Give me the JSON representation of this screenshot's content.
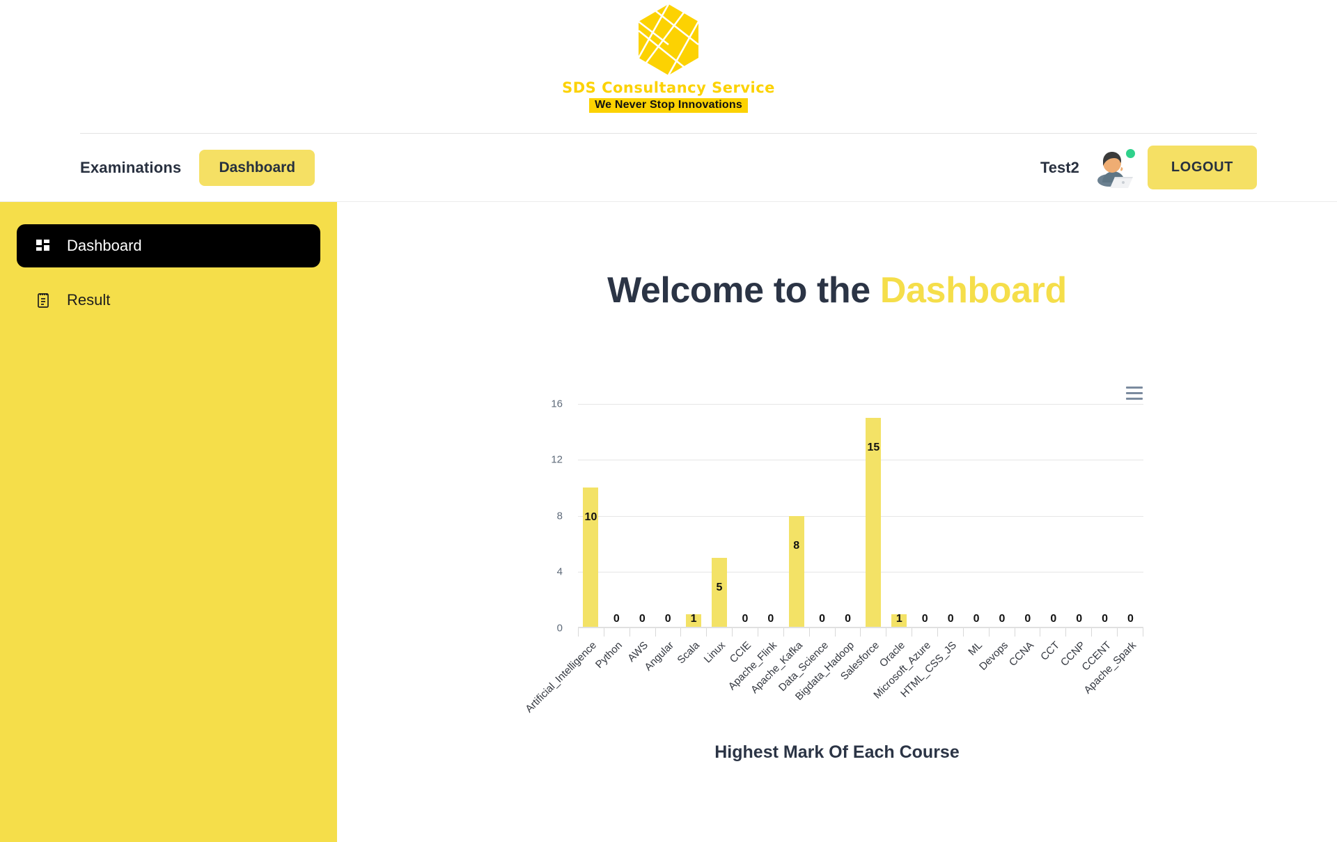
{
  "brand": {
    "logo_icon": "hexagon-logo-icon",
    "name": "SDS Consultancy Service",
    "tagline": "We Never Stop Innovations",
    "logo_color": "#FCD202"
  },
  "navbar": {
    "brand_label": "Examinations",
    "dashboard_tab": "Dashboard",
    "user_name": "Test2",
    "avatar_icon": "user-avatar-icon",
    "status_dot_color": "#2fd18b",
    "logout_label": "LOGOUT",
    "accent_color": "#F5E064"
  },
  "sidebar": {
    "background_color": "#F5DE4A",
    "items": [
      {
        "label": "Dashboard",
        "icon": "grid-dashboard-icon",
        "active": true
      },
      {
        "label": "Result",
        "icon": "clipboard-result-icon",
        "active": false
      }
    ]
  },
  "main": {
    "welcome_prefix": "Welcome to the ",
    "welcome_highlight": "Dashboard",
    "highlight_color": "#F5DE4A",
    "export_menu_icon": "hamburger-menu-icon"
  },
  "chart_data": {
    "type": "bar",
    "title": "Highest Mark Of Each Course",
    "subtitle": "",
    "xlabel": "",
    "ylabel": "",
    "ylim": [
      0,
      16
    ],
    "yticks": [
      0,
      4,
      8,
      12,
      16
    ],
    "grid": true,
    "legend": false,
    "bar_color": "#F3E266",
    "data_labels": true,
    "categories": [
      "Artificial_Intelligence",
      "Python",
      "AWS",
      "Angular",
      "Scala",
      "Linux",
      "CCIE",
      "Apache_Flink",
      "Apache_Kafka",
      "Data_Science",
      "Bigdata_Hadoop",
      "Salesforce",
      "Oracle",
      "Microsoft_Azure",
      "HTML_CSS_JS",
      "ML",
      "Devops",
      "CCNA",
      "CCT",
      "CCNP",
      "CCENT",
      "Apache_Spark"
    ],
    "values": [
      10,
      0,
      0,
      0,
      1,
      5,
      0,
      0,
      8,
      0,
      0,
      15,
      1,
      0,
      0,
      0,
      0,
      0,
      0,
      0,
      0,
      0
    ]
  }
}
